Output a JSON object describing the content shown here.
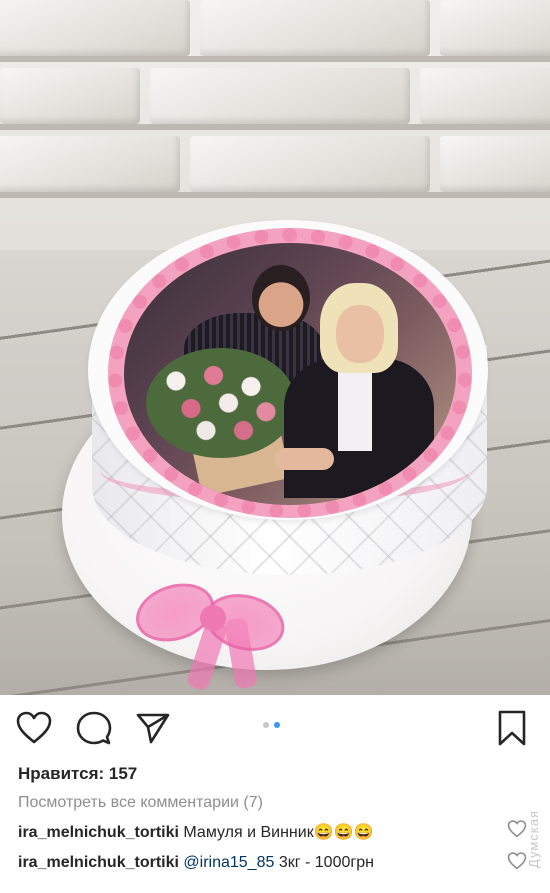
{
  "post": {
    "likes_label": "Нравится: 157",
    "view_comments_label": "Посмотреть все комментарии (7)",
    "comments": [
      {
        "user": "ira_melnichuk_tortiki",
        "mention": "",
        "text": "Мамуля и Винник",
        "emoji": "😄😄😄"
      },
      {
        "user": "ira_melnichuk_tortiki",
        "mention": "@irina15_85",
        "text": "3кг - 1000грн",
        "emoji": ""
      }
    ],
    "carousel": {
      "count": 2,
      "active_index": 1
    }
  },
  "watermark": "Думская",
  "icons": {
    "like": "heart-icon",
    "comment": "comment-bubble-icon",
    "share": "paper-plane-icon",
    "save": "bookmark-icon"
  },
  "colors": {
    "accent": "#3897f0",
    "mention": "#003569",
    "muted": "#8e8e8e"
  }
}
